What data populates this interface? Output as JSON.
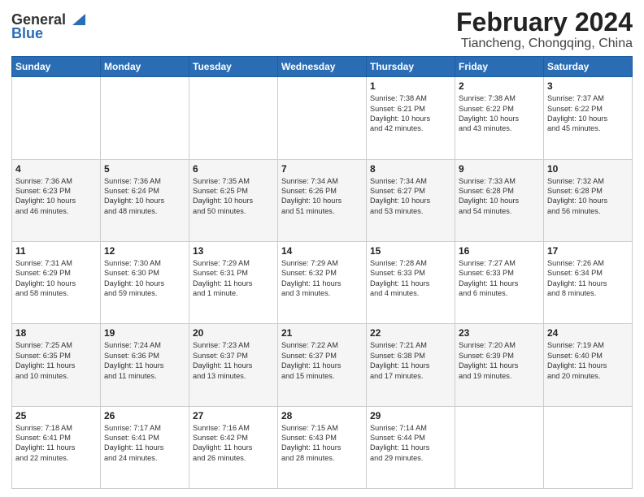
{
  "header": {
    "logo_general": "General",
    "logo_blue": "Blue",
    "month_title": "February 2024",
    "location": "Tiancheng, Chongqing, China"
  },
  "days_of_week": [
    "Sunday",
    "Monday",
    "Tuesday",
    "Wednesday",
    "Thursday",
    "Friday",
    "Saturday"
  ],
  "weeks": [
    [
      {
        "day": "",
        "info": ""
      },
      {
        "day": "",
        "info": ""
      },
      {
        "day": "",
        "info": ""
      },
      {
        "day": "",
        "info": ""
      },
      {
        "day": "1",
        "info": "Sunrise: 7:38 AM\nSunset: 6:21 PM\nDaylight: 10 hours\nand 42 minutes."
      },
      {
        "day": "2",
        "info": "Sunrise: 7:38 AM\nSunset: 6:22 PM\nDaylight: 10 hours\nand 43 minutes."
      },
      {
        "day": "3",
        "info": "Sunrise: 7:37 AM\nSunset: 6:22 PM\nDaylight: 10 hours\nand 45 minutes."
      }
    ],
    [
      {
        "day": "4",
        "info": "Sunrise: 7:36 AM\nSunset: 6:23 PM\nDaylight: 10 hours\nand 46 minutes."
      },
      {
        "day": "5",
        "info": "Sunrise: 7:36 AM\nSunset: 6:24 PM\nDaylight: 10 hours\nand 48 minutes."
      },
      {
        "day": "6",
        "info": "Sunrise: 7:35 AM\nSunset: 6:25 PM\nDaylight: 10 hours\nand 50 minutes."
      },
      {
        "day": "7",
        "info": "Sunrise: 7:34 AM\nSunset: 6:26 PM\nDaylight: 10 hours\nand 51 minutes."
      },
      {
        "day": "8",
        "info": "Sunrise: 7:34 AM\nSunset: 6:27 PM\nDaylight: 10 hours\nand 53 minutes."
      },
      {
        "day": "9",
        "info": "Sunrise: 7:33 AM\nSunset: 6:28 PM\nDaylight: 10 hours\nand 54 minutes."
      },
      {
        "day": "10",
        "info": "Sunrise: 7:32 AM\nSunset: 6:28 PM\nDaylight: 10 hours\nand 56 minutes."
      }
    ],
    [
      {
        "day": "11",
        "info": "Sunrise: 7:31 AM\nSunset: 6:29 PM\nDaylight: 10 hours\nand 58 minutes."
      },
      {
        "day": "12",
        "info": "Sunrise: 7:30 AM\nSunset: 6:30 PM\nDaylight: 10 hours\nand 59 minutes."
      },
      {
        "day": "13",
        "info": "Sunrise: 7:29 AM\nSunset: 6:31 PM\nDaylight: 11 hours\nand 1 minute."
      },
      {
        "day": "14",
        "info": "Sunrise: 7:29 AM\nSunset: 6:32 PM\nDaylight: 11 hours\nand 3 minutes."
      },
      {
        "day": "15",
        "info": "Sunrise: 7:28 AM\nSunset: 6:33 PM\nDaylight: 11 hours\nand 4 minutes."
      },
      {
        "day": "16",
        "info": "Sunrise: 7:27 AM\nSunset: 6:33 PM\nDaylight: 11 hours\nand 6 minutes."
      },
      {
        "day": "17",
        "info": "Sunrise: 7:26 AM\nSunset: 6:34 PM\nDaylight: 11 hours\nand 8 minutes."
      }
    ],
    [
      {
        "day": "18",
        "info": "Sunrise: 7:25 AM\nSunset: 6:35 PM\nDaylight: 11 hours\nand 10 minutes."
      },
      {
        "day": "19",
        "info": "Sunrise: 7:24 AM\nSunset: 6:36 PM\nDaylight: 11 hours\nand 11 minutes."
      },
      {
        "day": "20",
        "info": "Sunrise: 7:23 AM\nSunset: 6:37 PM\nDaylight: 11 hours\nand 13 minutes."
      },
      {
        "day": "21",
        "info": "Sunrise: 7:22 AM\nSunset: 6:37 PM\nDaylight: 11 hours\nand 15 minutes."
      },
      {
        "day": "22",
        "info": "Sunrise: 7:21 AM\nSunset: 6:38 PM\nDaylight: 11 hours\nand 17 minutes."
      },
      {
        "day": "23",
        "info": "Sunrise: 7:20 AM\nSunset: 6:39 PM\nDaylight: 11 hours\nand 19 minutes."
      },
      {
        "day": "24",
        "info": "Sunrise: 7:19 AM\nSunset: 6:40 PM\nDaylight: 11 hours\nand 20 minutes."
      }
    ],
    [
      {
        "day": "25",
        "info": "Sunrise: 7:18 AM\nSunset: 6:41 PM\nDaylight: 11 hours\nand 22 minutes."
      },
      {
        "day": "26",
        "info": "Sunrise: 7:17 AM\nSunset: 6:41 PM\nDaylight: 11 hours\nand 24 minutes."
      },
      {
        "day": "27",
        "info": "Sunrise: 7:16 AM\nSunset: 6:42 PM\nDaylight: 11 hours\nand 26 minutes."
      },
      {
        "day": "28",
        "info": "Sunrise: 7:15 AM\nSunset: 6:43 PM\nDaylight: 11 hours\nand 28 minutes."
      },
      {
        "day": "29",
        "info": "Sunrise: 7:14 AM\nSunset: 6:44 PM\nDaylight: 11 hours\nand 29 minutes."
      },
      {
        "day": "",
        "info": ""
      },
      {
        "day": "",
        "info": ""
      }
    ]
  ]
}
